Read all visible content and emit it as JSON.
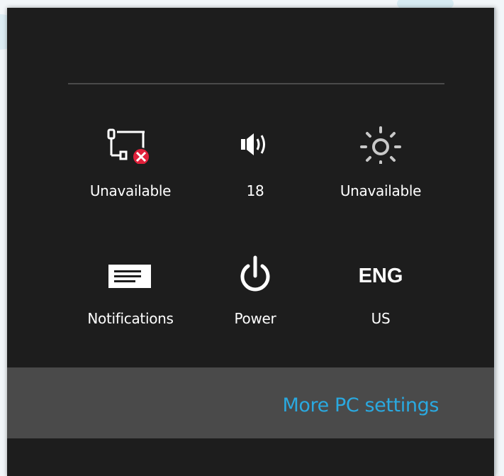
{
  "settings": {
    "tiles": [
      {
        "icon": "network-unavailable-icon",
        "label": "Unavailable"
      },
      {
        "icon": "volume-icon",
        "label": "18"
      },
      {
        "icon": "brightness-icon",
        "label": "Unavailable"
      },
      {
        "icon": "notifications-icon",
        "label": "Notifications"
      },
      {
        "icon": "power-icon",
        "label": "Power"
      },
      {
        "icon": "keyboard-language-icon",
        "text": "ENG",
        "label": "US"
      }
    ],
    "more_link": "More PC settings"
  },
  "colors": {
    "panel_bg": "#1d1d1d",
    "bar_bg": "#4a4a4a",
    "link": "#2aa9e0",
    "error_badge": "#e0203a"
  }
}
